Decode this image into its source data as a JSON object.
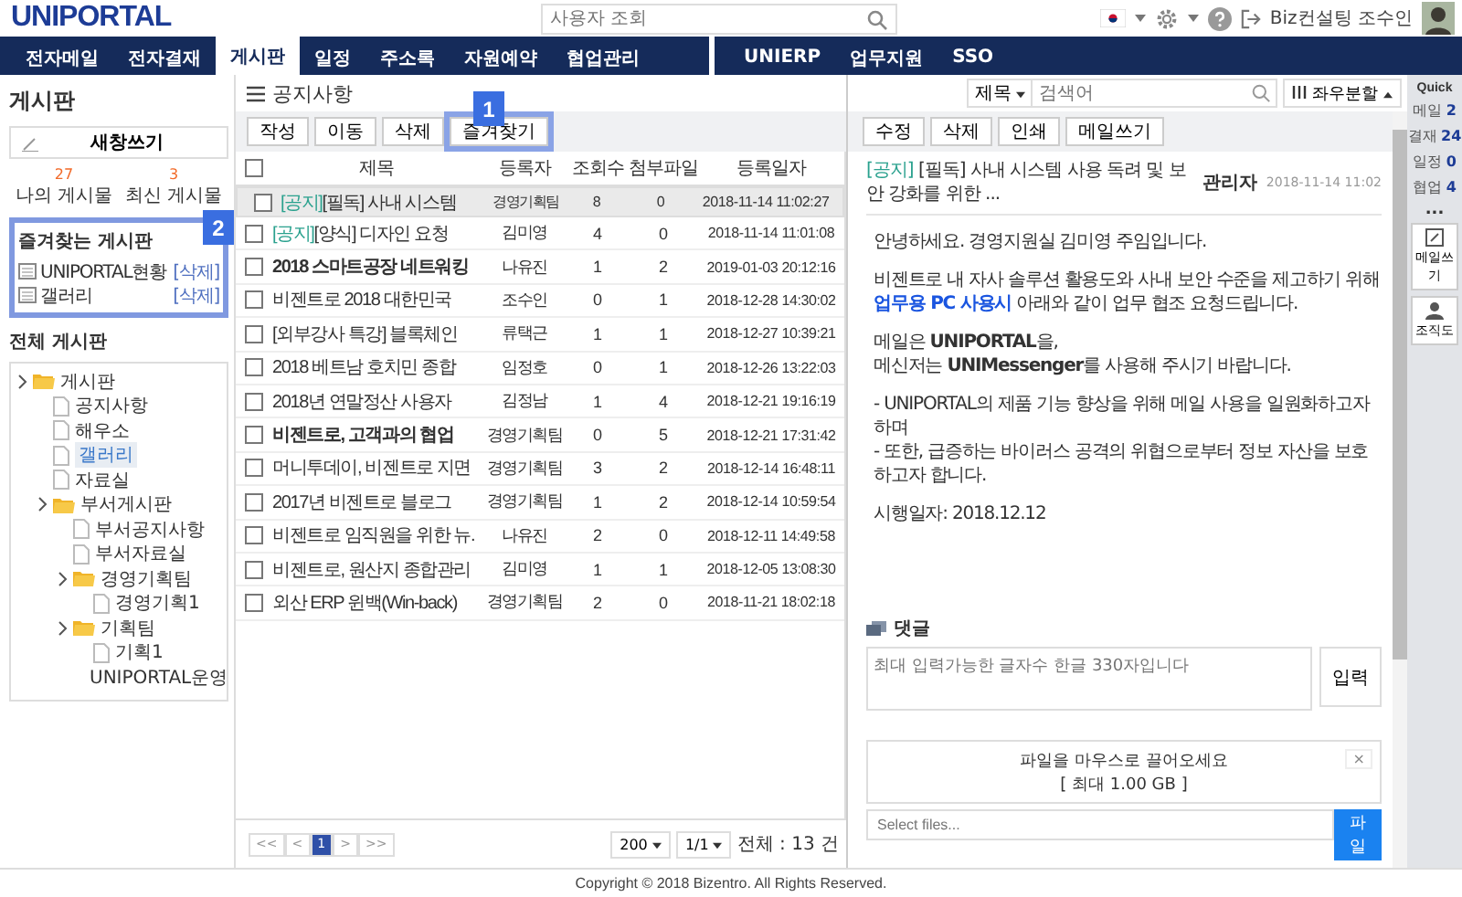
{
  "header": {
    "logo": "UNIPORTAL",
    "search_placeholder": "사용자 조회",
    "user": "Biz컨설팅 조수인"
  },
  "nav": {
    "left": [
      {
        "label": "전자메일",
        "selected": false
      },
      {
        "label": "전자결재",
        "selected": false
      },
      {
        "label": "게시판",
        "selected": true
      },
      {
        "label": "일정",
        "selected": false
      },
      {
        "label": "주소록",
        "selected": false
      },
      {
        "label": "자원예약",
        "selected": false
      },
      {
        "label": "협업관리",
        "selected": false
      }
    ],
    "right": [
      {
        "label": "UNIERP",
        "selected": false
      },
      {
        "label": "업무지원",
        "selected": false
      },
      {
        "label": "SSO",
        "selected": false
      }
    ]
  },
  "sidebar": {
    "title": "게시판",
    "write_button": "새창쓰기",
    "stats": [
      {
        "count": "27",
        "label": "나의 게시물"
      },
      {
        "count": "3",
        "label": "최신 게시물"
      }
    ],
    "favorites": {
      "title": "즐겨찾는 게시판",
      "highlighted": true,
      "items": [
        {
          "name": "UNIPORTAL현황",
          "action": "[삭제]"
        },
        {
          "name": "갤러리",
          "action": "[삭제]"
        }
      ]
    },
    "tree_title": "전체 게시판",
    "tree": [
      {
        "name": "게시판",
        "kind": "folder",
        "children": [
          {
            "name": "공지사항",
            "kind": "file",
            "selected": false
          },
          {
            "name": "해우소",
            "kind": "file",
            "selected": false
          },
          {
            "name": "갤러리",
            "kind": "file",
            "selected": true
          },
          {
            "name": "자료실",
            "kind": "file",
            "selected": false
          },
          {
            "name": "부서게시판",
            "kind": "folder",
            "children": [
              {
                "name": "부서공지사항",
                "kind": "file",
                "selected": false
              },
              {
                "name": "부서자료실",
                "kind": "file",
                "selected": false
              },
              {
                "name": "경영기획팀",
                "kind": "folder",
                "children": [
                  {
                    "name": "경영기획1",
                    "kind": "file",
                    "selected": false
                  }
                ]
              },
              {
                "name": "기획팀",
                "kind": "folder",
                "children": [
                  {
                    "name": "기획1",
                    "kind": "file",
                    "selected": false
                  },
                  {
                    "name": "UNIPORTAL운영",
                    "kind": "file",
                    "selected": false
                  }
                ]
              }
            ]
          }
        ]
      }
    ]
  },
  "list": {
    "title": "공지사항",
    "buttons": [
      {
        "label": "작성",
        "highlighted": false
      },
      {
        "label": "이동",
        "highlighted": false
      },
      {
        "label": "삭제",
        "highlighted": false
      },
      {
        "label": "즐겨찾기",
        "highlighted": true
      }
    ],
    "select_all_checked": false,
    "columns": [
      "제목",
      "등록자",
      "조회수",
      "첨부파일",
      "등록일자"
    ],
    "rows": [
      {
        "selected": true,
        "unread": false,
        "tag": "[공지]",
        "title": "[필독] 사내 시스템",
        "author": "경영기획팀",
        "views": "8",
        "files": "0",
        "date": "2018-11-14 11:02:27"
      },
      {
        "selected": false,
        "unread": false,
        "tag": "[공지]",
        "title": "[양식] 디자인 요청",
        "author": "김미영",
        "views": "4",
        "files": "0",
        "date": "2018-11-14 11:01:08"
      },
      {
        "selected": false,
        "unread": true,
        "title": "2018 스마트공장 네트워킹",
        "author": "나유진",
        "views": "1",
        "files": "2",
        "date": "2019-01-03 20:12:16"
      },
      {
        "selected": false,
        "unread": false,
        "title": "비젠트로 2018 대한민국",
        "author": "조수인",
        "views": "0",
        "files": "1",
        "date": "2018-12-28 14:30:02"
      },
      {
        "selected": false,
        "unread": false,
        "title": "[외부강사 특강] 블록체인",
        "author": "류택근",
        "views": "1",
        "files": "1",
        "date": "2018-12-27 10:39:21"
      },
      {
        "selected": false,
        "unread": false,
        "title": "2018 베트남 호치민 종합",
        "author": "임정호",
        "views": "0",
        "files": "1",
        "date": "2018-12-26 13:22:03"
      },
      {
        "selected": false,
        "unread": false,
        "title": "2018년 연말정산 사용자",
        "author": "김정남",
        "views": "1",
        "files": "4",
        "date": "2018-12-21 19:16:19"
      },
      {
        "selected": false,
        "unread": true,
        "title": "비젠트로, 고객과의 협업",
        "author": "경영기획팀",
        "views": "0",
        "files": "5",
        "date": "2018-12-21 17:31:42"
      },
      {
        "selected": false,
        "unread": false,
        "title": "머니투데이, 비젠트로 지면",
        "author": "경영기획팀",
        "views": "3",
        "files": "2",
        "date": "2018-12-14 16:48:11"
      },
      {
        "selected": false,
        "unread": false,
        "title": "2017년 비젠트로 블로그",
        "author": "경영기획팀",
        "views": "1",
        "files": "2",
        "date": "2018-12-14 10:59:54"
      },
      {
        "selected": false,
        "unread": false,
        "title": "비젠트로 임직원을 위한 뉴.",
        "author": "나유진",
        "views": "2",
        "files": "0",
        "date": "2018-12-11 14:49:58"
      },
      {
        "selected": false,
        "unread": false,
        "title": "비젠트로, 원산지 종합관리",
        "author": "김미영",
        "views": "1",
        "files": "1",
        "date": "2018-12-05 13:08:30"
      },
      {
        "selected": false,
        "unread": false,
        "title": "외산 ERP 윈백(Win-back)",
        "author": "경영기획팀",
        "views": "2",
        "files": "0",
        "date": "2018-11-21 18:02:18"
      }
    ],
    "pagination": {
      "first": "<<",
      "prev": "<",
      "pages": [
        {
          "label": "1",
          "selected": true
        }
      ],
      "next": ">",
      "last": ">>"
    },
    "page_size": "200",
    "page_of": "1/1",
    "total": "전체 : 13 건"
  },
  "detail": {
    "search": {
      "field": "제목",
      "placeholder": "검색어"
    },
    "split_button": "좌우분할",
    "buttons": [
      "수정",
      "삭제",
      "인쇄",
      "메일쓰기"
    ],
    "post": {
      "tag": "[공지]",
      "title": "[필독] 사내 시스템 사용 독려 및 보안 강화를 위한 ...",
      "author": "관리자",
      "date": "2018-11-14 11:02"
    },
    "body": [
      [
        {
          "text": "안녕하세요. 경영지원실 김미영 주임입니다."
        }
      ],
      [
        {
          "text": "비젠트로 내 자사 솔루션 활용도와 사내 보안 수준을 제고하기 위해"
        },
        {
          "link": "업무용 PC 사용시",
          "text": " 아래와 같이 업무 협조 요청드립니다."
        }
      ],
      [
        {
          "text": "메일은 **UNIPORTAL**을,"
        },
        {
          "text": "메신저는 **UNIMessenger**를 사용해 주시기 바랍니다."
        }
      ],
      [
        {
          "text": "- UNIPORTAL의 제품 기능 향상을 위해 메일 사용을 일원화하고자 하며"
        },
        {
          "text": "- 또한, 급증하는 바이러스 공격의 위협으로부터 정보 자산을 보호하고자 합니다."
        }
      ],
      [
        {
          "text": "시행일자: 2018.12.12"
        }
      ]
    ],
    "comments": {
      "title": "댓글",
      "placeholder": "최대 입력가능한 글자수 한글 330자입니다",
      "submit": "입력"
    },
    "upload": {
      "drop": "파일을 마우스로 끌어오세요",
      "limit": "[ 최대 1.00 GB ]",
      "close": "×",
      "placeholder": "Select files...",
      "button": "파일"
    }
  },
  "quick": {
    "title": "Quick",
    "items": [
      {
        "label": "메일",
        "count": "2"
      },
      {
        "label": "결재",
        "count": "24"
      },
      {
        "label": "일정",
        "count": "0"
      },
      {
        "label": "협업",
        "count": "4"
      }
    ],
    "more": "...",
    "tools": [
      {
        "label": "메일쓰기",
        "kind": "note"
      },
      {
        "label": "조직도",
        "kind": "person"
      }
    ]
  },
  "annotations": [
    {
      "number": "1"
    },
    {
      "number": "2"
    }
  ],
  "footer": "Copyright © 2018 Bizentro. All Rights Reserved."
}
